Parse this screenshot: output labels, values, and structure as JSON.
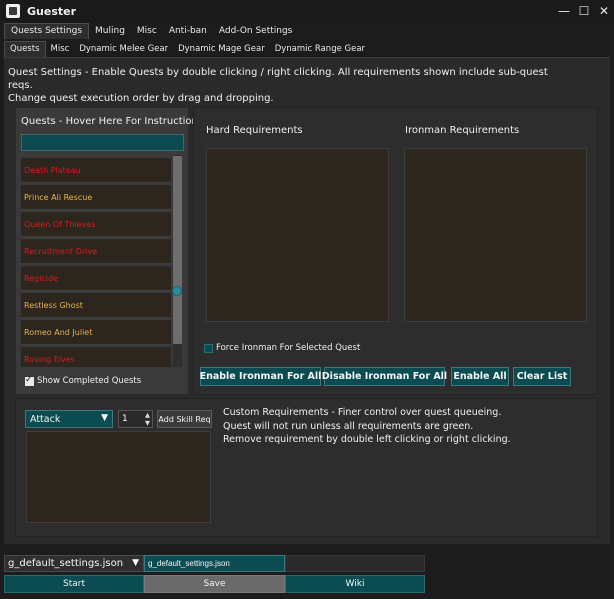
{
  "window": {
    "title": "Guester"
  },
  "window_controls": {
    "minimize": "—",
    "maximize": "☐",
    "close": "✕"
  },
  "tabs_main": [
    "Quests Settings",
    "Muling",
    "Misc",
    "Anti-ban",
    "Add-On Settings"
  ],
  "tabs_sub": [
    "Quests",
    "Misc",
    "Dynamic Melee Gear",
    "Dynamic Mage Gear",
    "Dynamic Range Gear"
  ],
  "description": "Quest Settings - Enable Quests by double clicking / right clicking. All requirements shown include sub-quest reqs.\nChange quest execution order by drag and dropping.",
  "quests": {
    "title": "Quests - Hover Here For Instructions",
    "search_value": "",
    "items": [
      {
        "name": "Death Plateau",
        "status": "red"
      },
      {
        "name": "Prince Ali Rescue",
        "status": "yellow"
      },
      {
        "name": "Queen Of Thieves",
        "status": "red"
      },
      {
        "name": "Recruitment Drive",
        "status": "red"
      },
      {
        "name": "Regicide",
        "status": "red"
      },
      {
        "name": "Restless Ghost",
        "status": "yellow"
      },
      {
        "name": "Romeo And Juliet",
        "status": "yellow"
      },
      {
        "name": "Roving Elves",
        "status": "red"
      }
    ],
    "show_completed_label": "Show Completed Quests",
    "show_completed_checked": true
  },
  "requirements": {
    "hard_label": "Hard Requirements",
    "ironman_label": "Ironman Requirements",
    "force_ironman_label": "Force Ironman For Selected Quest",
    "force_ironman_checked": false
  },
  "actions": {
    "enable_ironman": "Enable Ironman For All",
    "disable_ironman": "Disable Ironman For All",
    "enable_all": "Enable All",
    "clear_list": "Clear List"
  },
  "custom": {
    "skill_selected": "Attack",
    "level_value": "1",
    "add_skill_label": "Add Skill Req",
    "text": "Custom Requirements - Finer control over quest queueing.\nQuest will not run unless all requirements are green.\nRemove requirement by double left clicking or right clicking."
  },
  "settings_file": {
    "selected": "g_default_settings.json",
    "input_value": "g_default_settings.json"
  },
  "bottom_buttons": {
    "start": "Start",
    "save": "Save",
    "wiki": "Wiki"
  },
  "colors": {
    "teal": "#0b4b52",
    "quest_red": "#d41e1e",
    "quest_yellow": "#e4b64a",
    "list_bg": "#2c261e"
  }
}
